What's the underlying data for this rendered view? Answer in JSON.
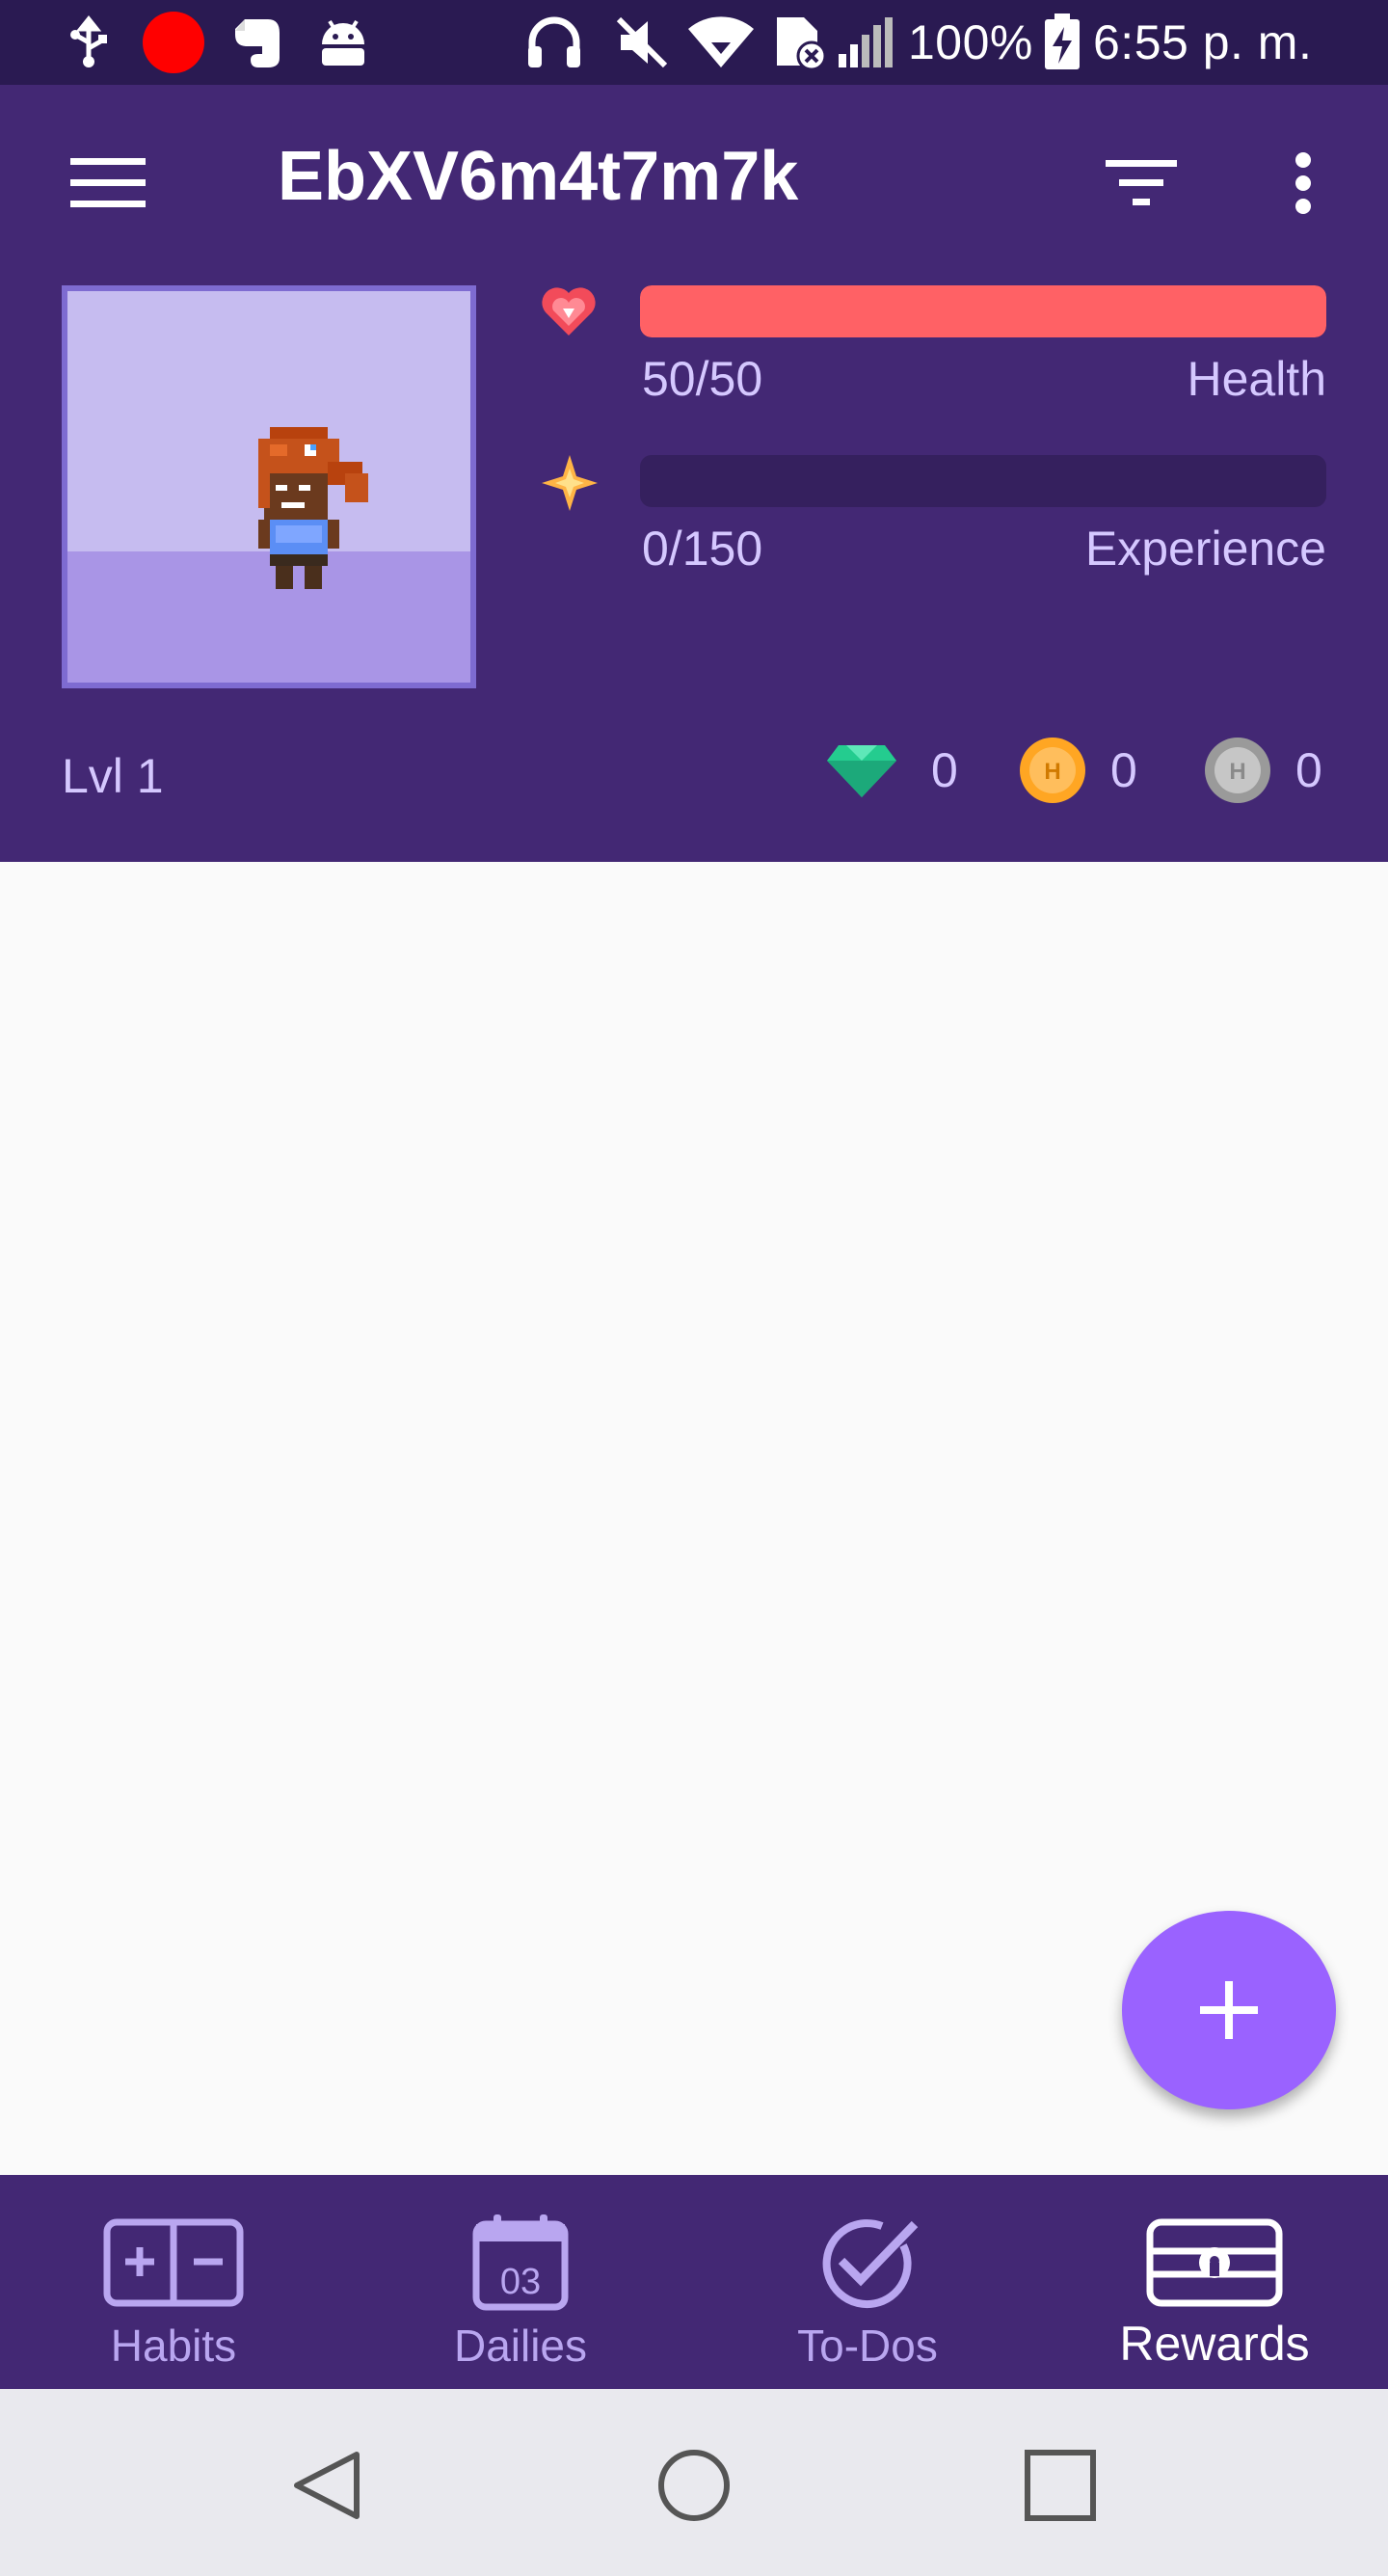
{
  "status_bar": {
    "battery": "100%",
    "time": "6:55 p. m."
  },
  "app_bar": {
    "title": "EbXV6m4t7m7k"
  },
  "stats": {
    "health": {
      "value_text": "50/50",
      "label": "Health",
      "fraction": 1.0,
      "color": "#ff6165"
    },
    "experience": {
      "value_text": "0/150",
      "label": "Experience",
      "fraction": 0.0
    },
    "level": "Lvl 1",
    "gems": "0",
    "gold": "0",
    "hourglasses": "0"
  },
  "bottom_nav": {
    "items": [
      {
        "label": "Habits",
        "icon": "habits-icon"
      },
      {
        "label": "Dailies",
        "icon": "calendar-icon",
        "calendar_day": "03"
      },
      {
        "label": "To-Dos",
        "icon": "check-circle-icon"
      },
      {
        "label": "Rewards",
        "icon": "treasure-chest-icon",
        "active": true
      }
    ]
  },
  "colors": {
    "primary": "#432874",
    "status_bar": "#2a1a52",
    "fab": "#9a62ff",
    "background": "#fafafa"
  }
}
